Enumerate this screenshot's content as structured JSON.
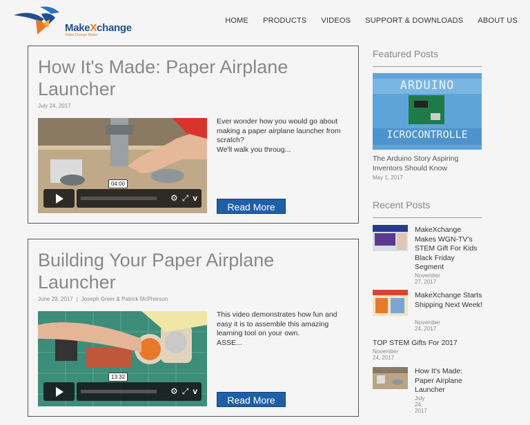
{
  "header": {
    "brand_main": "Make",
    "brand_x": "X",
    "brand_rest": "change",
    "brand_tagline": "Make Change Matter",
    "nav": [
      "HOME",
      "PRODUCTS",
      "VIDEOS",
      "SUPPORT & DOWNLOADS",
      "ABOUT US"
    ]
  },
  "posts": [
    {
      "title": "How It's Made: Paper Airplane Launcher",
      "date": "July 24, 2017",
      "authors": "",
      "excerpt": "Ever wonder how you would go about making a paper airplane launcher from scratch?\nWe'll walk you throug...",
      "video_time": "04:00",
      "read_more": "Read More"
    },
    {
      "title": "Building Your Paper Airplane Launcher",
      "date": "June 29, 2017",
      "authors": "Joseph Greer & Patrick McPherson",
      "excerpt": "This video demonstrates how fun and easy it is to assemble this amazing learning tool on your own.\nASSE...",
      "video_time": "13:32",
      "read_more": "Read More"
    }
  ],
  "sidebar": {
    "featured_heading": "Featured Posts",
    "featured": {
      "image_text_top": "ARDUINO",
      "image_text_bottom": "ICROCONTROLLE",
      "title": "The Arduino Story Aspiring Inventors Should Know",
      "date": "May 1, 2017"
    },
    "recent_heading": "Recent Posts",
    "recent": [
      {
        "title": "MakeXchange Makes WGN-TV's STEM Gift For Kids Black Friday Segment",
        "date": "November 27, 2017"
      },
      {
        "title": "MakeXchange Starts Shipping Next Week!",
        "date": "November 24, 2017"
      },
      {
        "title": "TOP STEM Gifts For 2017",
        "date": "November 24, 2017"
      },
      {
        "title": "How It's Made: Paper Airplane Launcher",
        "date": "July 24, 2017"
      }
    ]
  },
  "colors": {
    "brand_blue": "#1f4f8f",
    "brand_orange": "#e8792a",
    "button_blue": "#1f5fa8"
  },
  "icons": [
    "logo-bird-icon",
    "play-icon",
    "settings-icon",
    "fullscreen-icon",
    "vimeo-icon"
  ]
}
